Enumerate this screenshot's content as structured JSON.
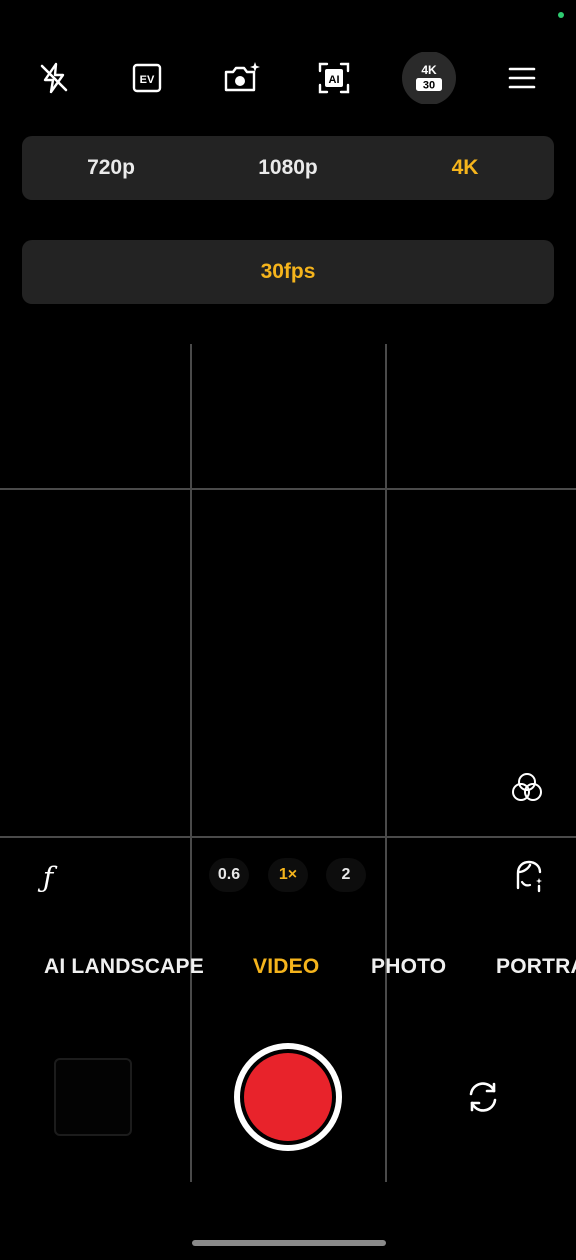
{
  "colors": {
    "accent": "#f5b41c",
    "record": "#e8232b",
    "status_dot": "#2ecc71",
    "text": "#ffffff",
    "panel": "#232323"
  },
  "top_bar": {
    "icons": [
      "flash-off-icon",
      "ev-icon",
      "camera-sparkle-icon",
      "ai-icon",
      "resolution-badge-icon",
      "menu-icon"
    ],
    "ev_label": "EV",
    "ai_label": "AI",
    "badge_res": "4K",
    "badge_fps": "30"
  },
  "resolution": {
    "options": [
      "720p",
      "1080p",
      "4K"
    ],
    "selected": "4K"
  },
  "frame_rate": {
    "options": [
      "30fps"
    ],
    "selected": "30fps"
  },
  "controls": {
    "filter_icon": "filter-circles-icon",
    "aperture_label": "ƒ",
    "portrait_icon": "face-retouch-icon",
    "switch_icon": "switch-camera-icon"
  },
  "zoom": {
    "options": [
      "0.6",
      "1×",
      "2"
    ],
    "selected": "1×"
  },
  "modes": {
    "items": [
      "AI LANDSCAPE",
      "VIDEO",
      "PHOTO",
      "PORTRA"
    ],
    "selected": "VIDEO"
  }
}
